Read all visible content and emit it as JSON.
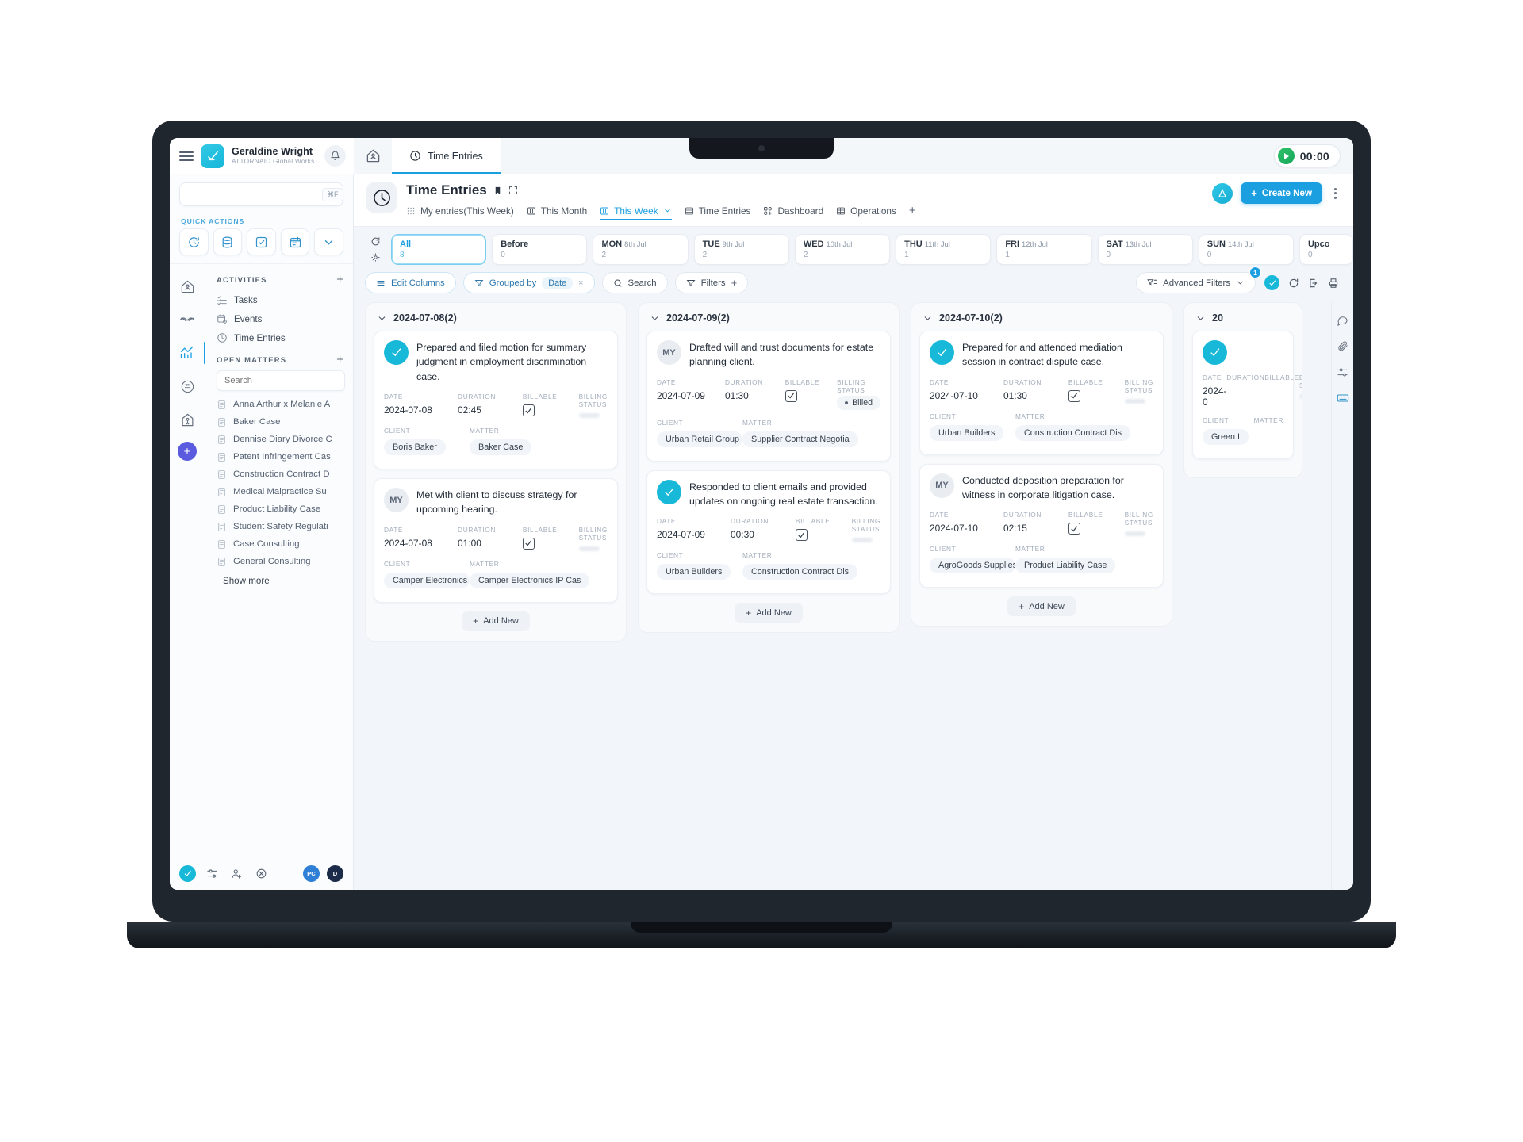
{
  "topbar": {
    "brand_name": "Geraldine Wright",
    "brand_sub": "ATTORNAID Global Works",
    "tab_home": "Home",
    "tab_time_entries": "Time Entries",
    "timer_value": "00:00"
  },
  "sidebar": {
    "search_placeholder": "",
    "search_shortcut": "⌘F",
    "quick_actions_title": "QUICK ACTIONS",
    "quick_actions": [
      {
        "name": "timer-icon"
      },
      {
        "name": "database-icon"
      },
      {
        "name": "checkbox-icon"
      },
      {
        "name": "calendar-icon"
      },
      {
        "name": "chevron-down-icon"
      }
    ],
    "activities_title": "ACTIVITIES",
    "activities": [
      {
        "label": "Tasks",
        "icon": "checklist-icon"
      },
      {
        "label": "Events",
        "icon": "calendar-event-icon"
      },
      {
        "label": "Time Entries",
        "icon": "clock-icon"
      }
    ],
    "open_matters_title": "OPEN MATTERS",
    "matters_search_placeholder": "Search",
    "matters": [
      "Anna Arthur x Melanie A",
      "Baker Case",
      "Dennise Diary Divorce C",
      "Patent Infringement Cas",
      "Construction Contract D",
      "Medical Malpractice Su",
      "Product Liability Case",
      "Student Safety Regulati",
      "Case Consulting",
      "General Consulting"
    ],
    "show_more": "Show more",
    "footer_avatars": [
      "PC",
      "D"
    ]
  },
  "page": {
    "title": "Time Entries",
    "tabs": [
      {
        "label": "My entries(This Week)",
        "icon": "grid-dots-icon",
        "active": false
      },
      {
        "label": "This Month",
        "icon": "board-icon",
        "active": false
      },
      {
        "label": "This Week",
        "icon": "board-icon",
        "active": true
      },
      {
        "label": "Time Entries",
        "icon": "table-icon",
        "active": false
      },
      {
        "label": "Dashboard",
        "icon": "dashboard-icon",
        "active": false
      },
      {
        "label": "Operations",
        "icon": "table-icon",
        "active": false
      }
    ],
    "add_tab": "+",
    "create_new": "Create New"
  },
  "date_strip": [
    {
      "name": "All",
      "date": "",
      "count": "8",
      "active": true
    },
    {
      "name": "Before",
      "date": "",
      "count": "0",
      "active": false
    },
    {
      "name": "MON",
      "date": "8th Jul",
      "count": "2",
      "active": false
    },
    {
      "name": "TUE",
      "date": "9th Jul",
      "count": "2",
      "active": false
    },
    {
      "name": "WED",
      "date": "10th Jul",
      "count": "2",
      "active": false
    },
    {
      "name": "THU",
      "date": "11th Jul",
      "count": "1",
      "active": false
    },
    {
      "name": "FRI",
      "date": "12th Jul",
      "count": "1",
      "active": false
    },
    {
      "name": "SAT",
      "date": "13th Jul",
      "count": "0",
      "active": false
    },
    {
      "name": "SUN",
      "date": "14th Jul",
      "count": "0",
      "active": false
    },
    {
      "name": "Upco",
      "date": "",
      "count": "0",
      "active": false
    }
  ],
  "toolbar": {
    "edit_columns": "Edit Columns",
    "grouped_by": "Grouped by",
    "grouped_value": "Date",
    "grouped_clear": "×",
    "search": "Search",
    "filters": "Filters",
    "filters_plus": "+",
    "advanced_filters": "Advanced Filters",
    "advanced_badge": "1"
  },
  "card_labels": {
    "date": "DATE",
    "duration": "DURATION",
    "billable": "BILLABLE",
    "billing_status": "BILLING STATUS",
    "client": "CLIENT",
    "matter": "MATTER",
    "add_new": "Add New"
  },
  "columns": [
    {
      "title": "2024-07-08(2)",
      "cards": [
        {
          "avatar": "logo",
          "avatar_text": "",
          "title": "Prepared and filed motion for summary judgment in employment discrimination case.",
          "date": "2024-07-08",
          "duration": "02:45",
          "billable": true,
          "billing_status": "",
          "client": "Boris Baker",
          "matter": "Baker Case"
        },
        {
          "avatar": "initials",
          "avatar_text": "MY",
          "title": "Met with client to discuss strategy for upcoming hearing.",
          "date": "2024-07-08",
          "duration": "01:00",
          "billable": true,
          "billing_status": "",
          "client": "Camper Electronics",
          "matter": "Camper Electronics IP Cas"
        }
      ]
    },
    {
      "title": "2024-07-09(2)",
      "cards": [
        {
          "avatar": "initials",
          "avatar_text": "MY",
          "title": "Drafted will and trust documents for estate planning client.",
          "date": "2024-07-09",
          "duration": "01:30",
          "billable": true,
          "billing_status": "Billed",
          "client": "Urban Retail Group",
          "matter": "Supplier Contract Negotia"
        },
        {
          "avatar": "logo",
          "avatar_text": "",
          "title": "Responded to client emails and provided updates on ongoing real estate transaction.",
          "date": "2024-07-09",
          "duration": "00:30",
          "billable": true,
          "billing_status": "",
          "client": "Urban Builders",
          "matter": "Construction Contract Dis"
        }
      ]
    },
    {
      "title": "2024-07-10(2)",
      "cards": [
        {
          "avatar": "logo",
          "avatar_text": "",
          "title": "Prepared for and attended mediation session in contract dispute case.",
          "date": "2024-07-10",
          "duration": "01:30",
          "billable": true,
          "billing_status": "",
          "client": "Urban Builders",
          "matter": "Construction Contract Dis"
        },
        {
          "avatar": "initials",
          "avatar_text": "MY",
          "title": "Conducted deposition preparation for witness in corporate litigation case.",
          "date": "2024-07-10",
          "duration": "02:15",
          "billable": true,
          "billing_status": "",
          "client": "AgroGoods Supplies",
          "matter": "Product Liability Case"
        }
      ]
    },
    {
      "title": "20",
      "partial": true,
      "cards": [
        {
          "avatar": "logo",
          "avatar_text": "",
          "title": "",
          "date": "2024-0",
          "duration": "",
          "billable": false,
          "billing_status": "",
          "client": "Green I",
          "matter": ""
        }
      ]
    }
  ],
  "colors": {
    "accent": "#1c9fe0",
    "brand_teal": "#18b9d8",
    "purple": "#5b5be0",
    "timer_green": "#17a95a"
  }
}
